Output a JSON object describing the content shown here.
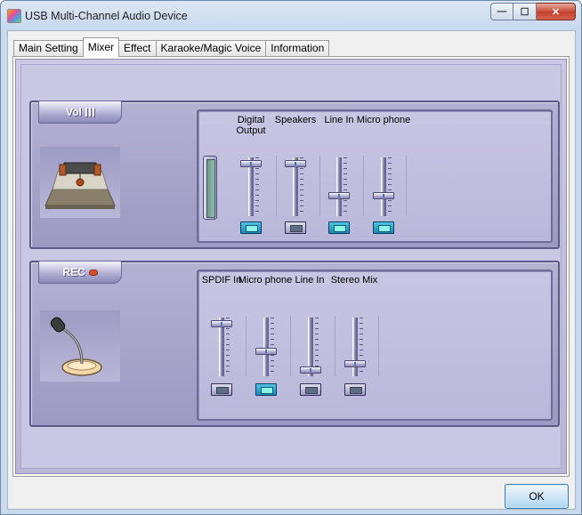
{
  "window": {
    "title": "USB Multi-Channel Audio Device"
  },
  "caption": {
    "minimize": "—",
    "maximize": "☐",
    "close": "✕"
  },
  "tabs": [
    {
      "label": "Main Setting",
      "active": false
    },
    {
      "label": "Mixer",
      "active": true
    },
    {
      "label": "Effect",
      "active": false
    },
    {
      "label": "Karaoke/Magic Voice",
      "active": false
    },
    {
      "label": "Information",
      "active": false
    }
  ],
  "volume": {
    "label": "Vol",
    "icon": "amplifier-icon",
    "channels": [
      {
        "label": "Digital Output",
        "level": 0.94,
        "mute_on": true
      },
      {
        "label": "Speakers",
        "level": 0.94,
        "mute_on": false
      },
      {
        "label": "Line In",
        "level": 0.33,
        "mute_on": true
      },
      {
        "label": "Micro phone",
        "level": 0.33,
        "mute_on": true
      }
    ]
  },
  "recording": {
    "label": "REC",
    "icon": "microphone-icon",
    "channels": [
      {
        "label": "SPDIF In",
        "level": 0.94,
        "mute_on": false
      },
      {
        "label": "Micro phone",
        "level": 0.42,
        "mute_on": true
      },
      {
        "label": "Line In",
        "level": 0.06,
        "mute_on": false
      },
      {
        "label": "Stereo Mix",
        "level": 0.17,
        "mute_on": false
      }
    ]
  },
  "footer": {
    "ok_label": "OK"
  },
  "colors": {
    "panel": "#c9c7e4",
    "group": "#b4b1d3",
    "mute_active": "#1787b5"
  }
}
